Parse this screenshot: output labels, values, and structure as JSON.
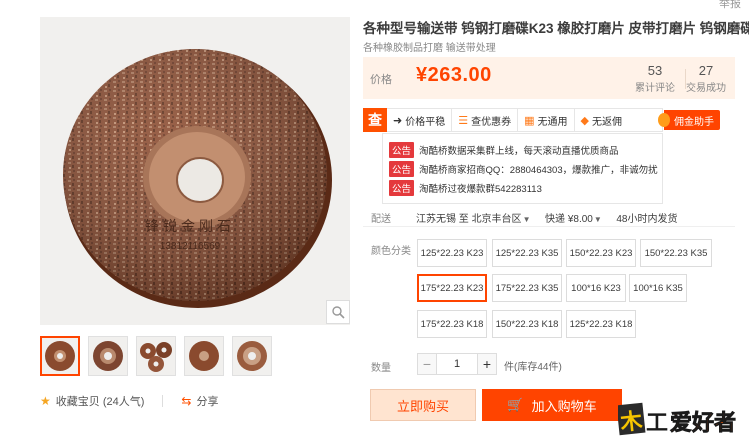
{
  "header": {
    "report": "举报"
  },
  "product": {
    "title": "各种型号输送带 钨钢打磨碟K23 橡胶打磨片 皮带打磨片 钨钢磨碟",
    "subtitle": "各种橡胶制品打磨 输送带处理",
    "price_label": "价格",
    "price": "¥263.00",
    "review_count": "53",
    "review_label": "累计评论",
    "deal_count": "27",
    "deal_label": "交易成功",
    "image_text_line1": "锋锐金刚石",
    "image_text_line2": "13812116569"
  },
  "promo": {
    "logo": "查",
    "items": [
      {
        "icon": "arrow-right-icon",
        "label": "价格平稳"
      },
      {
        "icon": "stack-icon",
        "label": "查优惠券"
      },
      {
        "icon": "store-icon",
        "label": "无通用"
      },
      {
        "icon": "tag-icon",
        "label": "无返佣"
      }
    ],
    "helper_label": "佣金助手"
  },
  "notices": [
    {
      "tag": "公告",
      "text": "淘酷桥数据采集群上线，每天滚动直播优质商品"
    },
    {
      "tag": "公告",
      "text": "淘酷桥商家招商QQ：2880464303，爆款推广，非诚勿扰"
    },
    {
      "tag": "公告",
      "text": "淘酷桥过夜爆款群542283113"
    }
  ],
  "shipping": {
    "label": "配送",
    "origin": "江苏无锡",
    "to": "至",
    "destination": "北京丰台区",
    "method": "快递 ¥8.00",
    "promise": "48小时内发货"
  },
  "sku": {
    "label": "颜色分类",
    "options": [
      "125*22.23 K23",
      "125*22.23 K35",
      "150*22.23 K23",
      "150*22.23 K35",
      "175*22.23 K23",
      "175*22.23 K35",
      "100*16 K23",
      "100*16 K35",
      "175*22.23 K18",
      "150*22.23 K18",
      "125*22.23 K18"
    ],
    "selected": "175*22.23 K23"
  },
  "quantity": {
    "label": "数量",
    "value": "1",
    "minus": "−",
    "plus": "+",
    "stock": "件(库存44件)"
  },
  "actions": {
    "buy_now": "立即购买",
    "add_cart": "加入购物车",
    "favorite": "收藏宝贝",
    "favorite_count": "(24人气)",
    "share": "分享"
  },
  "watermark": {
    "text": "木工爱好者"
  },
  "colors": {
    "accent": "#ff4400",
    "price_bg": "#fff2e8",
    "notice_tag": "#e4393c",
    "buy_now_bg": "#ffe4d0",
    "disc_brown": "#8a4a2e"
  }
}
